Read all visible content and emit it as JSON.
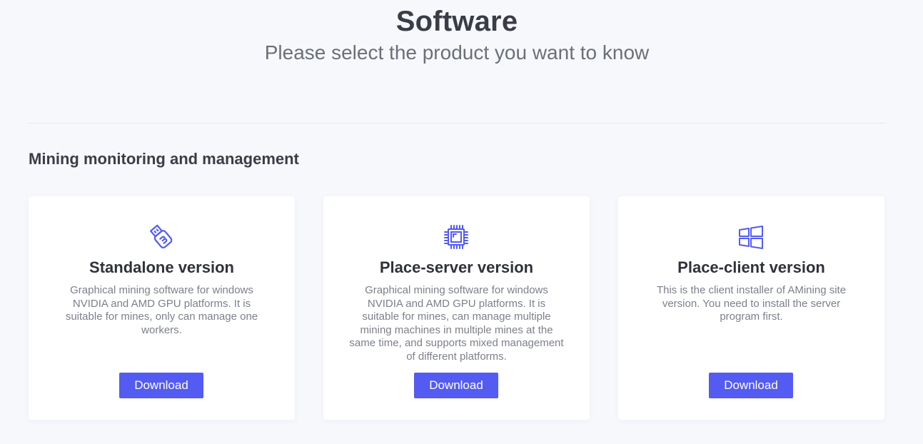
{
  "header": {
    "title": "Software",
    "subtitle": "Please select the product you want to know"
  },
  "section": {
    "title": "Mining monitoring and management"
  },
  "colors": {
    "accent": "#535bf2",
    "background": "#f7f8fc",
    "card": "#ffffff"
  },
  "cards": [
    {
      "icon": "usb-drive-icon",
      "title": "Standalone version",
      "description": "Graphical mining software for windows NVIDIA and AMD GPU platforms. It is suitable for mines, only can manage one workers.",
      "button_label": "Download"
    },
    {
      "icon": "cpu-chip-icon",
      "title": "Place-server version",
      "description": "Graphical mining software for windows NVIDIA and AMD GPU platforms. It is suitable for mines, can manage multiple mining machines in multiple mines at the same time, and supports mixed management of different platforms.",
      "button_label": "Download"
    },
    {
      "icon": "windows-logo-icon",
      "title": "Place-client version",
      "description": "This is the client installer of AMining site version. You need to install the server program first.",
      "button_label": "Download"
    }
  ]
}
